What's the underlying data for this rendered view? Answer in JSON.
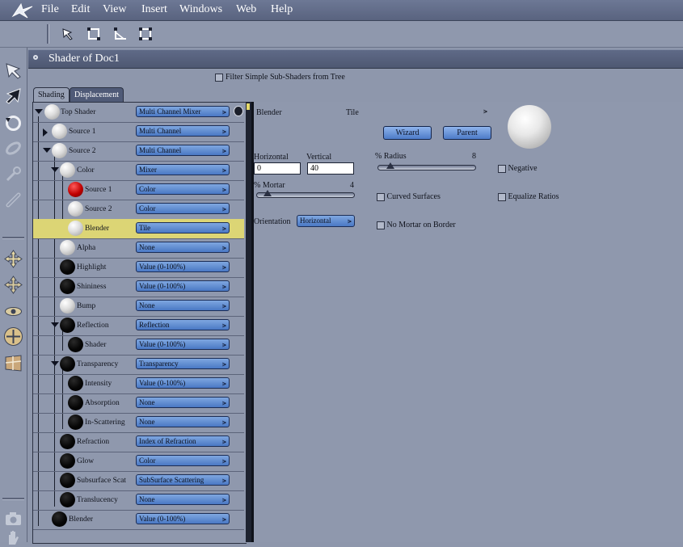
{
  "menubar": {
    "items": [
      "File",
      "Edit",
      "View",
      "Insert",
      "Windows",
      "Web",
      "Help"
    ]
  },
  "toolbar": {
    "tools": [
      "arrow-select-icon",
      "rect-select-icon",
      "vertex-select-icon",
      "box-select-icon"
    ]
  },
  "leftstrip": {
    "tools": [
      "pointer-tool-icon",
      "direct-select-icon",
      "rotate-tool-icon",
      "link-tool-icon",
      "wrench-tool-icon",
      "chain-tool-icon",
      "move-tool-icon",
      "pan-tool-icon",
      "scale-tool-icon",
      "trackball-tool-icon",
      "texture-tool-icon",
      "camera-icon",
      "hand-icon"
    ]
  },
  "panel": {
    "title": "Shader of Doc1",
    "filter_label": "Filter Simple Sub-Shaders from Tree",
    "tabs": [
      "Shading",
      "Displacement"
    ]
  },
  "tree": [
    {
      "label": "Top Shader",
      "ball": "white",
      "value": "Multi Channel Mixer"
    },
    {
      "label": "Source 1",
      "ball": "white",
      "value": "Multi Channel"
    },
    {
      "label": "Source 2",
      "ball": "white",
      "value": "Multi Channel"
    },
    {
      "label": "Color",
      "ball": "white",
      "value": "Mixer"
    },
    {
      "label": "Source 1",
      "ball": "red",
      "value": "Color"
    },
    {
      "label": "Source 2",
      "ball": "white",
      "value": "Color"
    },
    {
      "label": "Blender",
      "ball": "white",
      "value": "Tile"
    },
    {
      "label": "Alpha",
      "ball": "white",
      "value": "None"
    },
    {
      "label": "Highlight",
      "ball": "black",
      "value": "Value (0-100%)"
    },
    {
      "label": "Shininess",
      "ball": "black",
      "value": "Value (0-100%)"
    },
    {
      "label": "Bump",
      "ball": "white",
      "value": "None"
    },
    {
      "label": "Reflection",
      "ball": "black",
      "value": "Reflection"
    },
    {
      "label": "Shader",
      "ball": "black",
      "value": "Value (0-100%)"
    },
    {
      "label": "Transparency",
      "ball": "black",
      "value": "Transparency"
    },
    {
      "label": "Intensity",
      "ball": "black",
      "value": "Value (0-100%)"
    },
    {
      "label": "Absorption",
      "ball": "black",
      "value": "None"
    },
    {
      "label": "In-Scattering",
      "ball": "black",
      "value": "None"
    },
    {
      "label": "Refraction",
      "ball": "black",
      "value": "Index of Refraction"
    },
    {
      "label": "Glow",
      "ball": "black",
      "value": "Color"
    },
    {
      "label": "Subsurface Scat",
      "ball": "black",
      "value": "SubSurface Scattering"
    },
    {
      "label": "Translucency",
      "ball": "black",
      "value": "None"
    },
    {
      "label": "Blender",
      "ball": "black",
      "value": "Value (0-100%)"
    }
  ],
  "editor": {
    "shader_name": "Blender",
    "shader_type": "Tile",
    "wizard_label": "Wizard",
    "parent_label": "Parent",
    "horizontal_label": "Horizontal",
    "horizontal_value": "0",
    "vertical_label": "Vertical",
    "vertical_value": "40",
    "radius_label": "% Radius",
    "radius_value": "8",
    "mortar_label": "% Mortar",
    "mortar_value": "4",
    "orientation_label": "Orientation",
    "orientation_value": "Horizontal",
    "negative_label": "Negative",
    "curved_label": "Curved Surfaces",
    "equalize_label": "Equalize Ratios",
    "no_mortar_label": "No Mortar on Border"
  }
}
